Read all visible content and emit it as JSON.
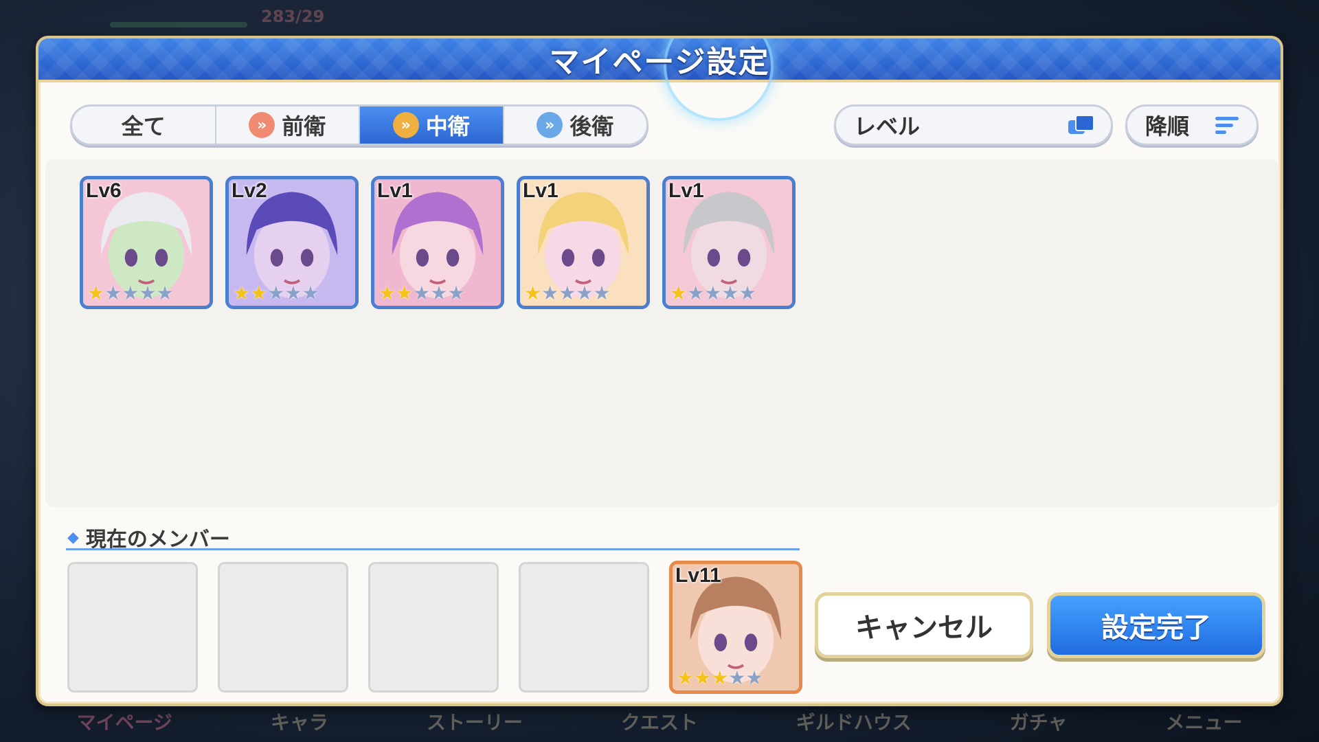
{
  "background": {
    "stamina": "283/29",
    "nav": [
      "マイページ",
      "キャラ",
      "ストーリー",
      "クエスト",
      "ギルドハウス",
      "ガチャ",
      "メニュー"
    ]
  },
  "dialog": {
    "title": "マイページ設定"
  },
  "filters": {
    "tabs": [
      {
        "label": "全て",
        "icon": null,
        "active": false
      },
      {
        "label": "前衛",
        "icon": "front-position-icon",
        "active": false
      },
      {
        "label": "中衛",
        "icon": "middle-position-icon",
        "active": true
      },
      {
        "label": "後衛",
        "icon": "rear-position-icon",
        "active": false
      }
    ],
    "sort_key": "レベル",
    "sort_order": "降順"
  },
  "characters": [
    {
      "level": "Lv6",
      "stars": 1,
      "palette": [
        "#f4c6d6",
        "#eaeaf0",
        "#cfe8c4"
      ]
    },
    {
      "level": "Lv2",
      "stars": 2,
      "palette": [
        "#c8b8f0",
        "#5a4bb8",
        "#e6d0f0"
      ]
    },
    {
      "level": "Lv1",
      "stars": 2,
      "palette": [
        "#f0b8d0",
        "#b070d0",
        "#f8d8e0"
      ]
    },
    {
      "level": "Lv1",
      "stars": 1,
      "palette": [
        "#fbe0c0",
        "#f3d27a",
        "#f6d8e6"
      ]
    },
    {
      "level": "Lv1",
      "stars": 1,
      "palette": [
        "#f4c8d4",
        "#c8c8cc",
        "#f0dbe2"
      ]
    }
  ],
  "members": {
    "label": "現在のメンバー",
    "slots": [
      {
        "empty": true
      },
      {
        "empty": true
      },
      {
        "empty": true
      },
      {
        "empty": true
      },
      {
        "empty": false,
        "level": "Lv11",
        "stars": 3,
        "palette": [
          "#f0c8b0",
          "#b88060",
          "#f8e0d8"
        ]
      }
    ]
  },
  "buttons": {
    "cancel": "キャンセル",
    "confirm": "設定完了"
  }
}
